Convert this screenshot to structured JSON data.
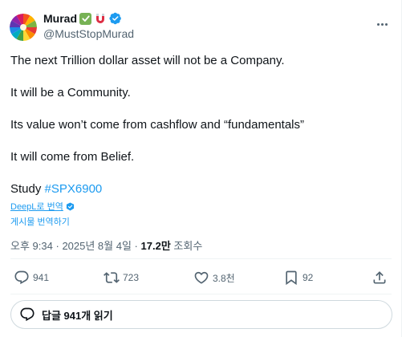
{
  "author": {
    "display_name": "Murad",
    "handle": "@MustStopMurad",
    "emoji_badges": [
      "check-mark-button-emoji",
      "magnet-emoji"
    ],
    "verified_color": "#1d9bf0"
  },
  "post": {
    "lines": [
      "The next Trillion dollar asset will not be a Company.",
      "It will be a Community.",
      "Its value won’t come from cashflow and “fundamentals”",
      "It will come from Belief."
    ],
    "study_prefix": "Study",
    "hashtag": "#SPX6900"
  },
  "translation": {
    "deepl_label": "DeepL로 번역",
    "translate_post_label": "게시물 번역하기"
  },
  "meta": {
    "time": "오후 9:34",
    "separator": "·",
    "date": "2025년 8월 4일",
    "views_count": "17.2만",
    "views_label": "조회수"
  },
  "actions": {
    "replies": "941",
    "reposts": "723",
    "likes": "3.8천",
    "bookmarks": "92"
  },
  "read_replies_label": "답글 941개 읽기",
  "colors": {
    "accent": "#1d9bf0",
    "text": "#0f1419",
    "secondary": "#536471",
    "border": "#eff3f4"
  }
}
